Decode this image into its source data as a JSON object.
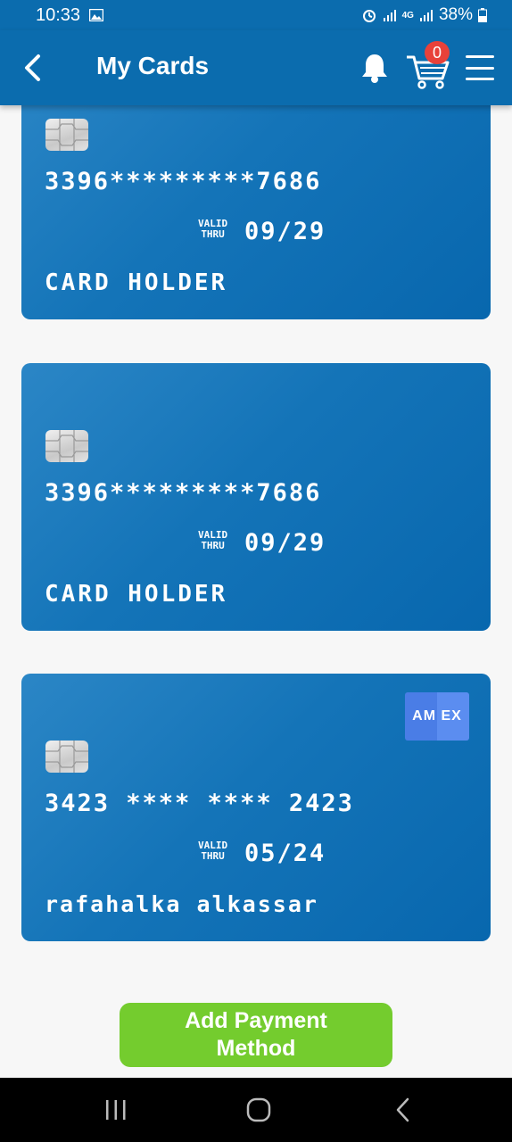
{
  "status_bar": {
    "time": "10:33",
    "battery": "38%",
    "network": "4G",
    "icons": [
      "image-icon",
      "alarm-icon",
      "signal-icon",
      "battery-icon"
    ]
  },
  "app_bar": {
    "title": "My Cards",
    "cart_count": "0",
    "icons": [
      "back-arrow-icon",
      "bell-icon",
      "cart-icon",
      "menu-icon"
    ]
  },
  "cards": [
    {
      "number": "3396*********7686",
      "valid_label_1": "VALID",
      "valid_label_2": "THRU",
      "expiry": "09/29",
      "holder": "CARD HOLDER",
      "brand": ""
    },
    {
      "number": "3396*********7686",
      "valid_label_1": "VALID",
      "valid_label_2": "THRU",
      "expiry": "09/29",
      "holder": "CARD HOLDER",
      "brand": ""
    },
    {
      "number": "3423 **** **** 2423",
      "valid_label_1": "VALID",
      "valid_label_2": "THRU",
      "expiry": "05/24",
      "holder": "rafahalka alkassar",
      "brand": "AM EX"
    }
  ],
  "add_button": {
    "label_line1": "Add Payment",
    "label_line2": "Method"
  },
  "colors": {
    "primary": "#0b6cae",
    "card": "#1474b8",
    "accent_green": "#74cc2e",
    "badge": "#e8413a"
  }
}
